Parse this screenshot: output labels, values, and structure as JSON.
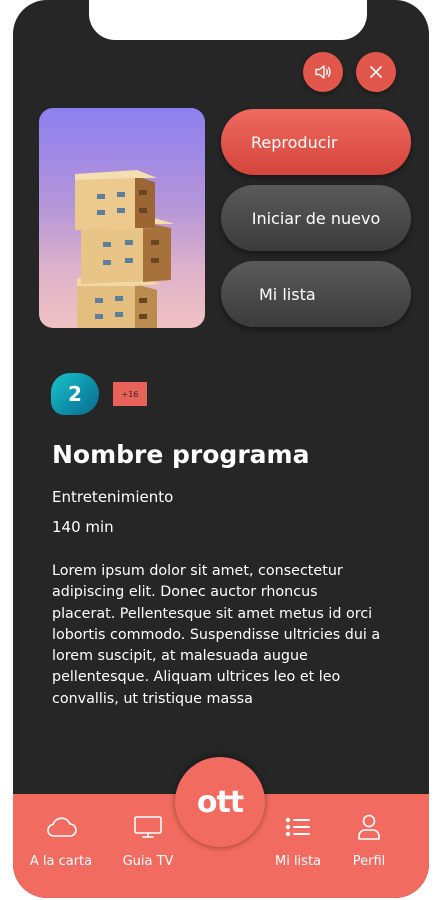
{
  "header": {
    "volume_icon": "speaker-icon",
    "close_icon": "close-icon"
  },
  "actions": {
    "play_label": "Reproducir",
    "restart_label": "Iniciar de nuevo",
    "mylist_label": "Mi lista"
  },
  "program": {
    "channel_logo_text": "2",
    "age_rating": "+16",
    "title": "Nombre programa",
    "genre": "Entretenimiento",
    "duration": "140 min",
    "description": "Lorem ipsum dolor sit amet, consectetur adipiscing elit. Donec auctor rhoncus placerat. Pellentesque sit amet metus id orci lobortis commodo. Suspendisse ultricies dui a lorem suscipit, at malesuada augue pellentesque. Aliquam ultrices leo et leo convallis, ut tristique massa"
  },
  "nav": {
    "logo_text": "ott",
    "items": [
      {
        "label": "A la carta",
        "icon": "cloud-icon"
      },
      {
        "label": "Guia TV",
        "icon": "tv-icon"
      },
      {
        "label": "Mi lista",
        "icon": "list-icon"
      },
      {
        "label": "Perfil",
        "icon": "user-icon"
      }
    ]
  },
  "colors": {
    "accent": "#f26b60",
    "background": "#262626",
    "button_dark": "#4a4a4a",
    "channel": "#19c6c9"
  }
}
